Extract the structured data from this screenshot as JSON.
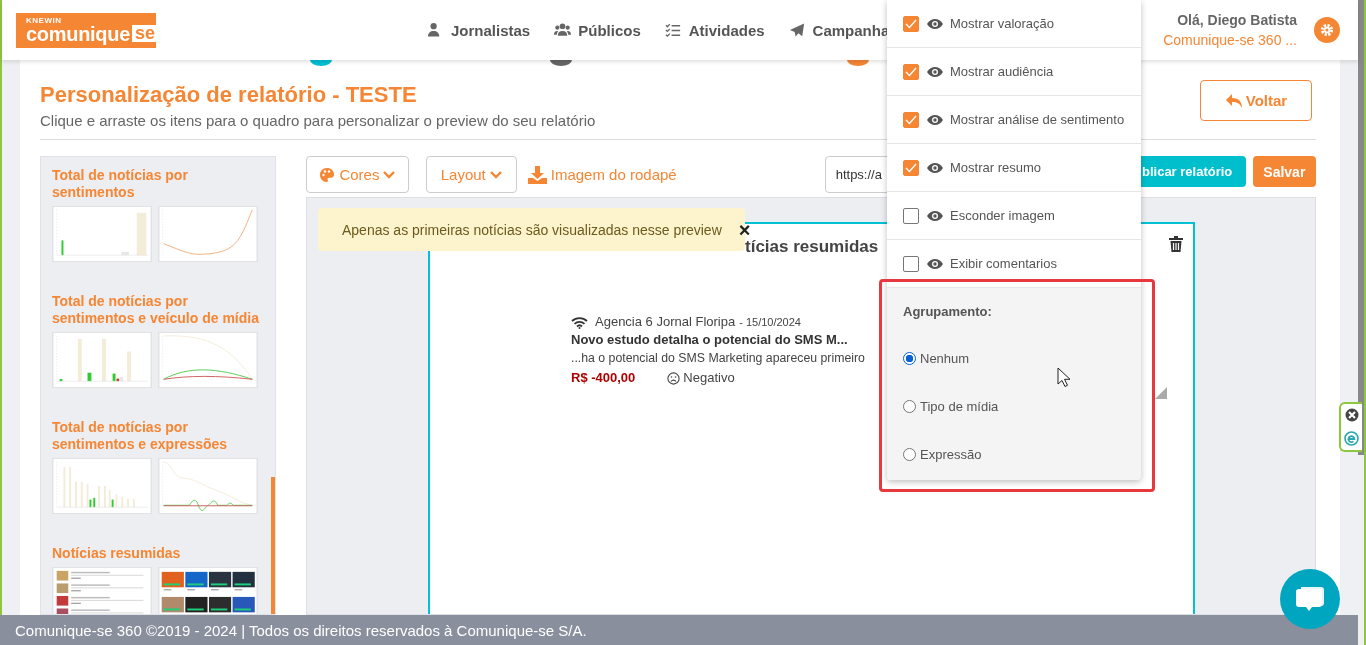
{
  "logo": {
    "brand": "KNEWIN",
    "name": "comunique",
    "suffix": "se"
  },
  "nav": [
    {
      "label": "Jornalistas"
    },
    {
      "label": "Públicos"
    },
    {
      "label": "Atividades"
    },
    {
      "label": "Campanha"
    }
  ],
  "user": {
    "greeting": "Olá, Diego Batista",
    "account": "Comunique-se 360 ..."
  },
  "steps": [
    {
      "color": "#00bfd3"
    },
    {
      "color": "#666666"
    },
    {
      "color": "#f58634"
    }
  ],
  "page": {
    "title": "Personalização de relatório - TESTE",
    "subtitle": "Clique e arraste os itens para o quadro para personalizar o preview do seu relatório",
    "back_button": "Voltar"
  },
  "widgets": [
    {
      "title": "Total de notícias por sentimentos",
      "thumbnails": [
        {
          "kind": "bar"
        },
        {
          "kind": "line"
        }
      ]
    },
    {
      "title": "Total de notícias por sentimentos e veículo de mídia",
      "thumbnails": [
        {
          "kind": "bar"
        },
        {
          "kind": "line"
        }
      ]
    },
    {
      "title": "Total de notícias por sentimentos e expressões",
      "thumbnails": [
        {
          "kind": "bar"
        },
        {
          "kind": "line"
        }
      ]
    },
    {
      "title": "Notícias resumidas",
      "thumbnails": [
        {
          "kind": "list"
        },
        {
          "kind": "grid"
        }
      ]
    }
  ],
  "toolbar": {
    "colors_button": "Cores",
    "layout_button": "Layout",
    "footer_image_link": "Imagem do rodapé",
    "url": "https://a",
    "publish_button": "blicar relatório",
    "save_button": "Salvar"
  },
  "notice": {
    "text": "Apenas as primeiras notícias são visualizadas nesse preview",
    "close": "×"
  },
  "preview": {
    "title": "tícias resumidas",
    "news": [
      {
        "source": "Agencia 6 Jornal Floripa",
        "date": "- 15/10/2024",
        "headline": "Novo estudo detalha o potencial do SMS M...",
        "summary": "...ha o potencial do SMS Marketing apareceu primeiro",
        "value": "R$ -400,00",
        "sentiment": "Negativo"
      }
    ]
  },
  "menu": {
    "options": [
      {
        "label": "Mostrar valoração",
        "checked": true
      },
      {
        "label": "Mostrar audiência",
        "checked": true
      },
      {
        "label": "Mostrar análise de sentimento",
        "checked": true
      },
      {
        "label": "Mostrar resumo",
        "checked": true
      },
      {
        "label": "Esconder imagem",
        "checked": false
      },
      {
        "label": "Exibir comentarios",
        "checked": false
      }
    ],
    "group_label": "Agrupamento:",
    "grouping": [
      {
        "label": "Nenhum",
        "selected": true
      },
      {
        "label": "Tipo de mídia",
        "selected": false
      },
      {
        "label": "Expressão",
        "selected": false
      }
    ]
  },
  "footer": "Comunique-se 360 ©2019 - 2024 | Todos os direitos reservados à Comunique-se S/A."
}
